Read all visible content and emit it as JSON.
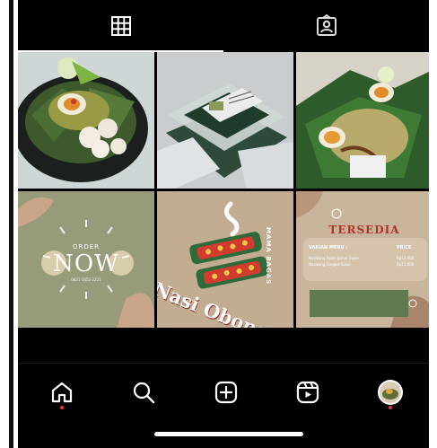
{
  "profile_tabs": [
    {
      "icon": "grid-icon",
      "active": true
    },
    {
      "icon": "tagged-person-icon",
      "active": false
    }
  ],
  "posts": [
    {
      "kind": "photo",
      "subject": "nasi-obong-plate"
    },
    {
      "kind": "photo",
      "subject": "packaged-boxes"
    },
    {
      "kind": "photo",
      "subject": "nasi-obong-leaf"
    },
    {
      "kind": "promo",
      "small_top": "ORDER",
      "big": "NOW",
      "small_bottom": "0821-3452-2221"
    },
    {
      "kind": "logo",
      "title": "Nasi Obong",
      "brand": "MAMA BAGAS"
    },
    {
      "kind": "menu",
      "heading": "TERSEDIA",
      "col_menu": "VARIAN MENU :",
      "col_price": "PRICE",
      "items": [
        {
          "name": "Nasikong Ayam Jamur Suwir",
          "price": "Rp13,000"
        },
        {
          "name": "Nasikong Tongkol Suwir",
          "price": "Rp11,000"
        }
      ]
    }
  ],
  "bottom_nav": [
    {
      "icon": "home-icon",
      "badge": true
    },
    {
      "icon": "search-icon",
      "badge": false
    },
    {
      "icon": "create-post-icon",
      "badge": false
    },
    {
      "icon": "reels-icon",
      "badge": false
    },
    {
      "icon": "profile-avatar-icon",
      "badge": true
    }
  ],
  "colors": {
    "background": "#000000",
    "accent_dot": "#e8313f",
    "tile_beige": "#c2ad93"
  }
}
